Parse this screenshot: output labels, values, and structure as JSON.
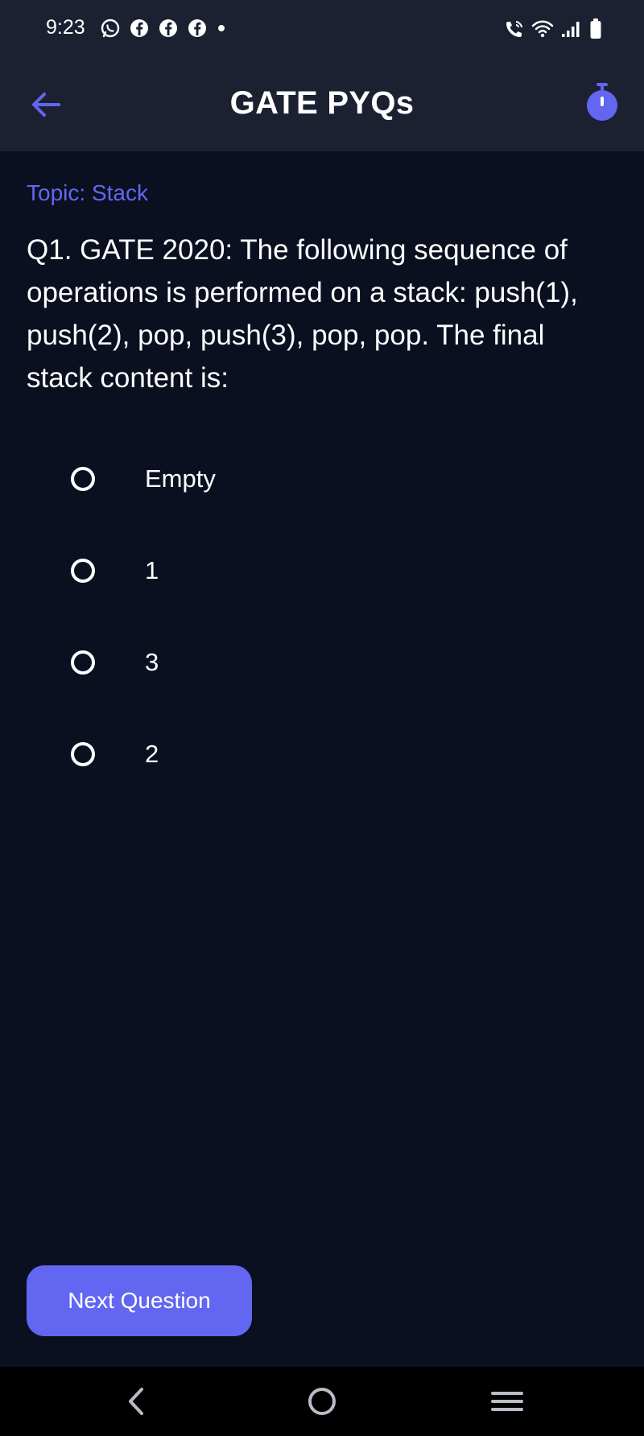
{
  "status_bar": {
    "time": "9:23",
    "left_icons": [
      "whatsapp-icon",
      "facebook-icon",
      "facebook-icon",
      "facebook-icon",
      "dot-icon"
    ],
    "right_icons": [
      "wifi-call-icon",
      "wifi-icon",
      "signal-icon",
      "battery-icon"
    ]
  },
  "app_bar": {
    "title": "GATE PYQs",
    "back_icon": "arrow-left-icon",
    "timer_icon": "stopwatch-icon"
  },
  "question": {
    "topic": "Topic: Stack",
    "text": "Q1. GATE 2020: The following sequence of operations is performed on a stack: push(1), push(2), pop, push(3), pop, pop. The final stack content is:",
    "options": [
      {
        "label": "Empty",
        "selected": false
      },
      {
        "label": "1",
        "selected": false
      },
      {
        "label": "3",
        "selected": false
      },
      {
        "label": "2",
        "selected": false
      }
    ]
  },
  "actions": {
    "next_label": "Next Question"
  },
  "nav_bar": {
    "icons": [
      "back-nav-icon",
      "home-nav-icon",
      "recents-nav-icon"
    ]
  },
  "colors": {
    "accent": "#6366f1",
    "background": "#0b1020",
    "header": "#1b2130"
  }
}
